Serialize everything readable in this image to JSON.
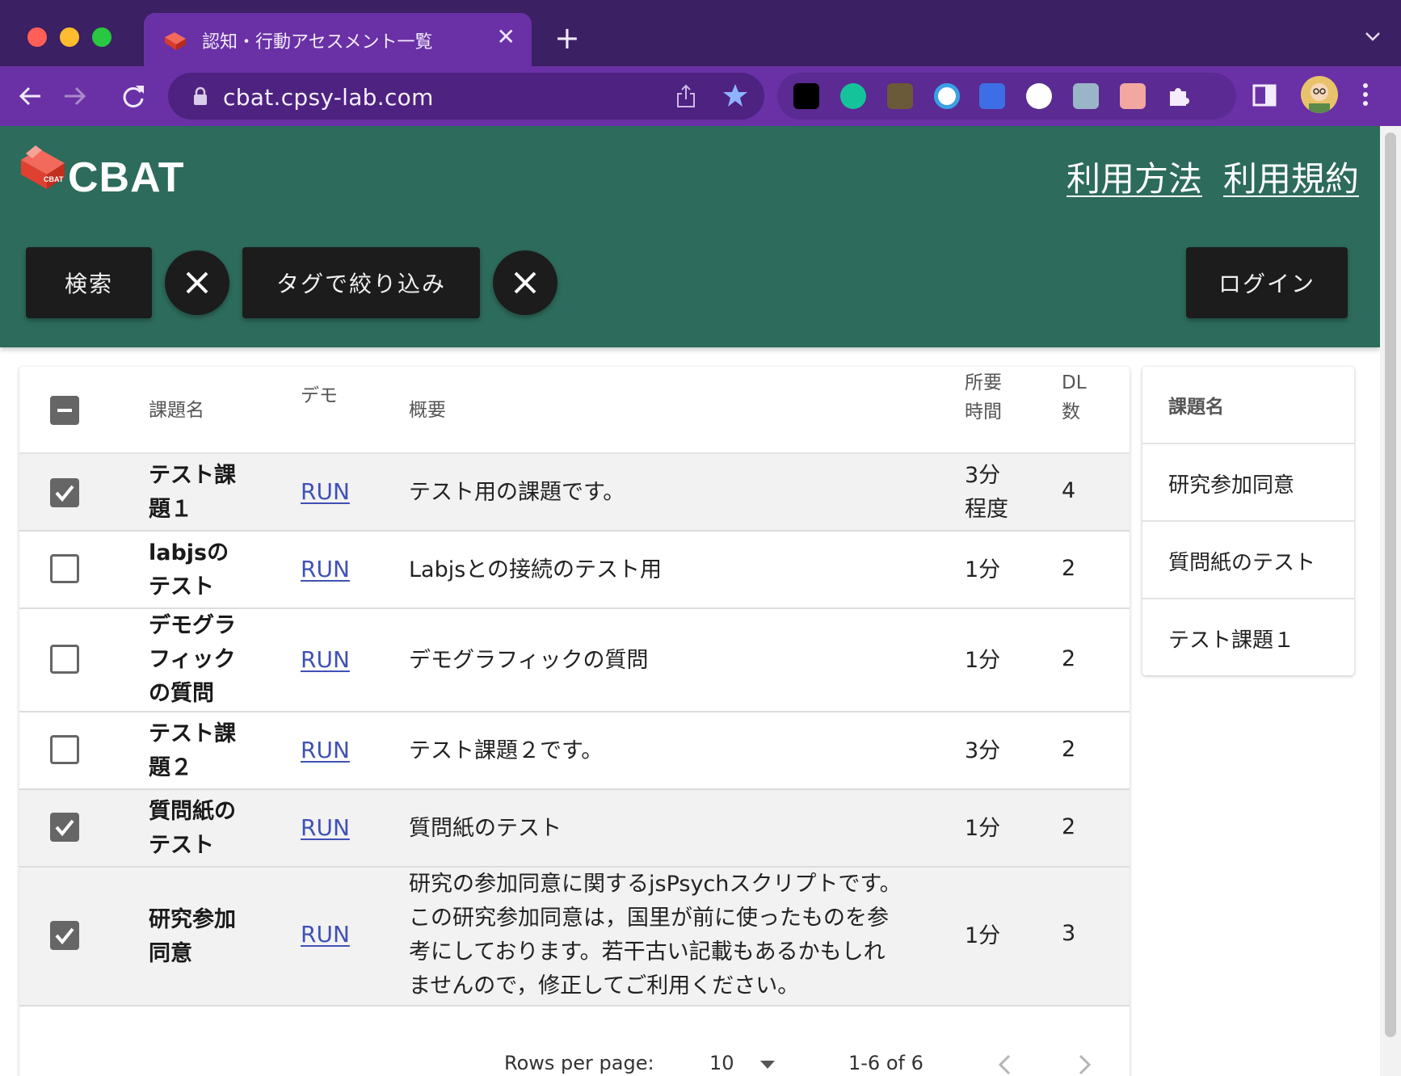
{
  "browser": {
    "tab_title": "認知・行動アセスメント一覧",
    "url": "cbat.cpsy-lab.com"
  },
  "header": {
    "logo_badge": "CBAT",
    "logo_text": "CBAT",
    "links": [
      "利用方法",
      "利用規約"
    ]
  },
  "toolbar": {
    "search_label": "検索",
    "tag_filter_label": "タグで絞り込み",
    "login_label": "ログイン"
  },
  "table": {
    "columns": {
      "name": "課題名",
      "demo": "デモ",
      "summary": "概要",
      "time": "所要時間",
      "dl": "DL数"
    },
    "rows": [
      {
        "name": "テスト課題１",
        "demo": "RUN",
        "summary": "テスト用の課題です。",
        "time": "3分程度",
        "dl": "4",
        "checked": true
      },
      {
        "name": "labjsのテスト",
        "demo": "RUN",
        "summary": "Labjsとの接続のテスト用",
        "time": "1分",
        "dl": "2",
        "checked": false
      },
      {
        "name": "デモグラフィックの質問",
        "demo": "RUN",
        "summary": "デモグラフィックの質問",
        "time": "1分",
        "dl": "2",
        "checked": false
      },
      {
        "name": "テスト課題２",
        "demo": "RUN",
        "summary": "テスト課題２です。",
        "time": "3分",
        "dl": "2",
        "checked": false
      },
      {
        "name": "質問紙のテスト",
        "demo": "RUN",
        "summary": "質問紙のテスト",
        "time": "1分",
        "dl": "2",
        "checked": true
      },
      {
        "name": "研究参加同意",
        "demo": "RUN",
        "summary": "研究の参加同意に関するjsPsychスクリプトです。この研究参加同意は，国里が前に使ったものを参考にしております。若干古い記載もあるかもしれませんので，修正してご利用ください。",
        "time": "1分",
        "dl": "3",
        "checked": true
      }
    ],
    "pagination": {
      "rows_per_page_label": "Rows per page:",
      "rows_per_page": "10",
      "range": "1-6 of 6"
    }
  },
  "selected_list": {
    "header": "課題名",
    "items": [
      "研究参加同意",
      "質問紙のテスト",
      "テスト課題１"
    ]
  },
  "colors": {
    "tab_strip": "#3b2063",
    "browser_toolbar": "#6a31a6",
    "app_bar": "#2d6b5c",
    "dark_button": "#1c1c1c",
    "link": "#3f51b5",
    "checkbox": "#666666"
  }
}
